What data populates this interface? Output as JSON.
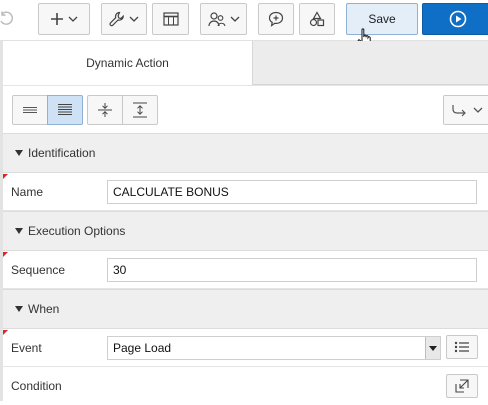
{
  "toolbar": {
    "save_label": "Save",
    "accent_color": "#0f6fc6",
    "icons": [
      "undo-icon",
      "plus-icon",
      "wrench-icon",
      "grid-icon",
      "shared-components-icon",
      "comment-icon",
      "shapes-icon",
      "play-icon"
    ]
  },
  "tabs": [
    {
      "label": "Dynamic Action",
      "active": true
    }
  ],
  "view_controls": {
    "icons": [
      "show-common-icon",
      "show-all-icon",
      "collapse-all-icon",
      "expand-all-icon",
      "go-to-group-icon"
    ],
    "selected": "show-all-icon"
  },
  "sections": {
    "identification": {
      "title": "Identification",
      "name_label": "Name",
      "name_value": "CALCULATE BONUS"
    },
    "execution_options": {
      "title": "Execution Options",
      "sequence_label": "Sequence",
      "sequence_value": "30"
    },
    "when": {
      "title": "When",
      "event_label": "Event",
      "event_value": "Page Load",
      "condition_label": "Condition"
    }
  }
}
